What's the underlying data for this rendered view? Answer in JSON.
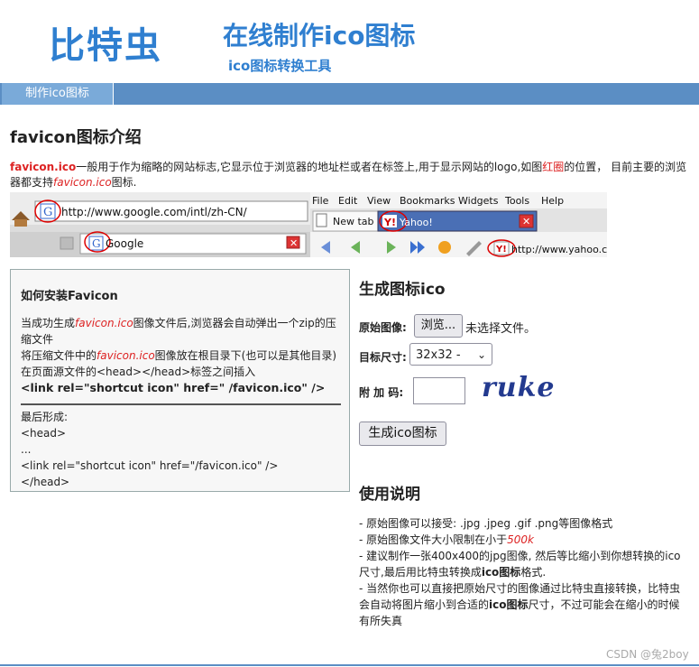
{
  "header": {
    "logo": "比特虫",
    "title": "在线制作ico图标",
    "subtitle": "ico图标转换工具"
  },
  "nav": {
    "tab": "制作ico图标"
  },
  "intro": {
    "heading": "favicon图标介绍",
    "t1": "favicon.ico",
    "t2": "一般用于作为缩略的网站标志,它显示位于浏览器的地址栏或者在标签上,用于显示网站的logo,如图",
    "t3": "红圈",
    "t4": "的位置， 目前主要的浏览器都支持",
    "t5": "favicon.ico",
    "t6": "图标."
  },
  "browser": {
    "left_url": "http://www.google.com/intl/zh-CN/",
    "left_tab": "Google",
    "menu": [
      "File",
      "Edit",
      "View",
      "Bookmarks",
      "Widgets",
      "Tools",
      "Help"
    ],
    "newtab": "New tab",
    "yahoo_tab": "Yahoo!",
    "yahoo_url": "http://www.yahoo.com"
  },
  "install": {
    "title": "如何安装Favicon",
    "l1a": "当成功生成",
    "l1b": "favicon.ico",
    "l1c": "图像文件后,浏览器会自动弹出一个zip的压缩文件",
    "l2a": "将压缩文件中的",
    "l2b": "favicon.ico",
    "l2c": "图像放在根目录下(也可以是其他目录)",
    "l3": "在页面源文件的<head></head>标签之间插入",
    "l4": "<link rel=\"shortcut icon\" href=\" /favicon.ico\" />",
    "a1": "最后形成:",
    "a2": "<head>",
    "a3": "...",
    "a4": "<link rel=\"shortcut icon\" href=\"/favicon.ico\" />",
    "a5": "</head>"
  },
  "generator": {
    "title": "生成图标ico",
    "image_label": "原始图像:",
    "browse": "浏览...",
    "no_file": "未选择文件。",
    "size_label": "目标尺寸:",
    "size_value": "32x32 -",
    "code_label": "附 加 码:",
    "captcha": "ruke",
    "submit": "生成ico图标"
  },
  "usage": {
    "title": "使用说明",
    "u1": "- 原始图像可以接受: .jpg .jpeg .gif .png等图像格式",
    "u2a": "- 原始图像文件大小限制在小于",
    "u2b": "500k",
    "u3": "- 建议制作一张400x400的jpg图像, 然后等比缩小到你想转换的ico尺寸,最后用比特虫转换成",
    "u3b": "ico图标",
    "u3c": "格式.",
    "u4a": "- 当然你也可以直接把原始尺寸的图像通过比特虫直接转换，比特虫会自动将图片缩小到合适的",
    "u4b": "ico图标",
    "u4c": "尺寸，不过可能会在缩小的时候有所失真"
  },
  "watermark": "CSDN @兔2boy"
}
